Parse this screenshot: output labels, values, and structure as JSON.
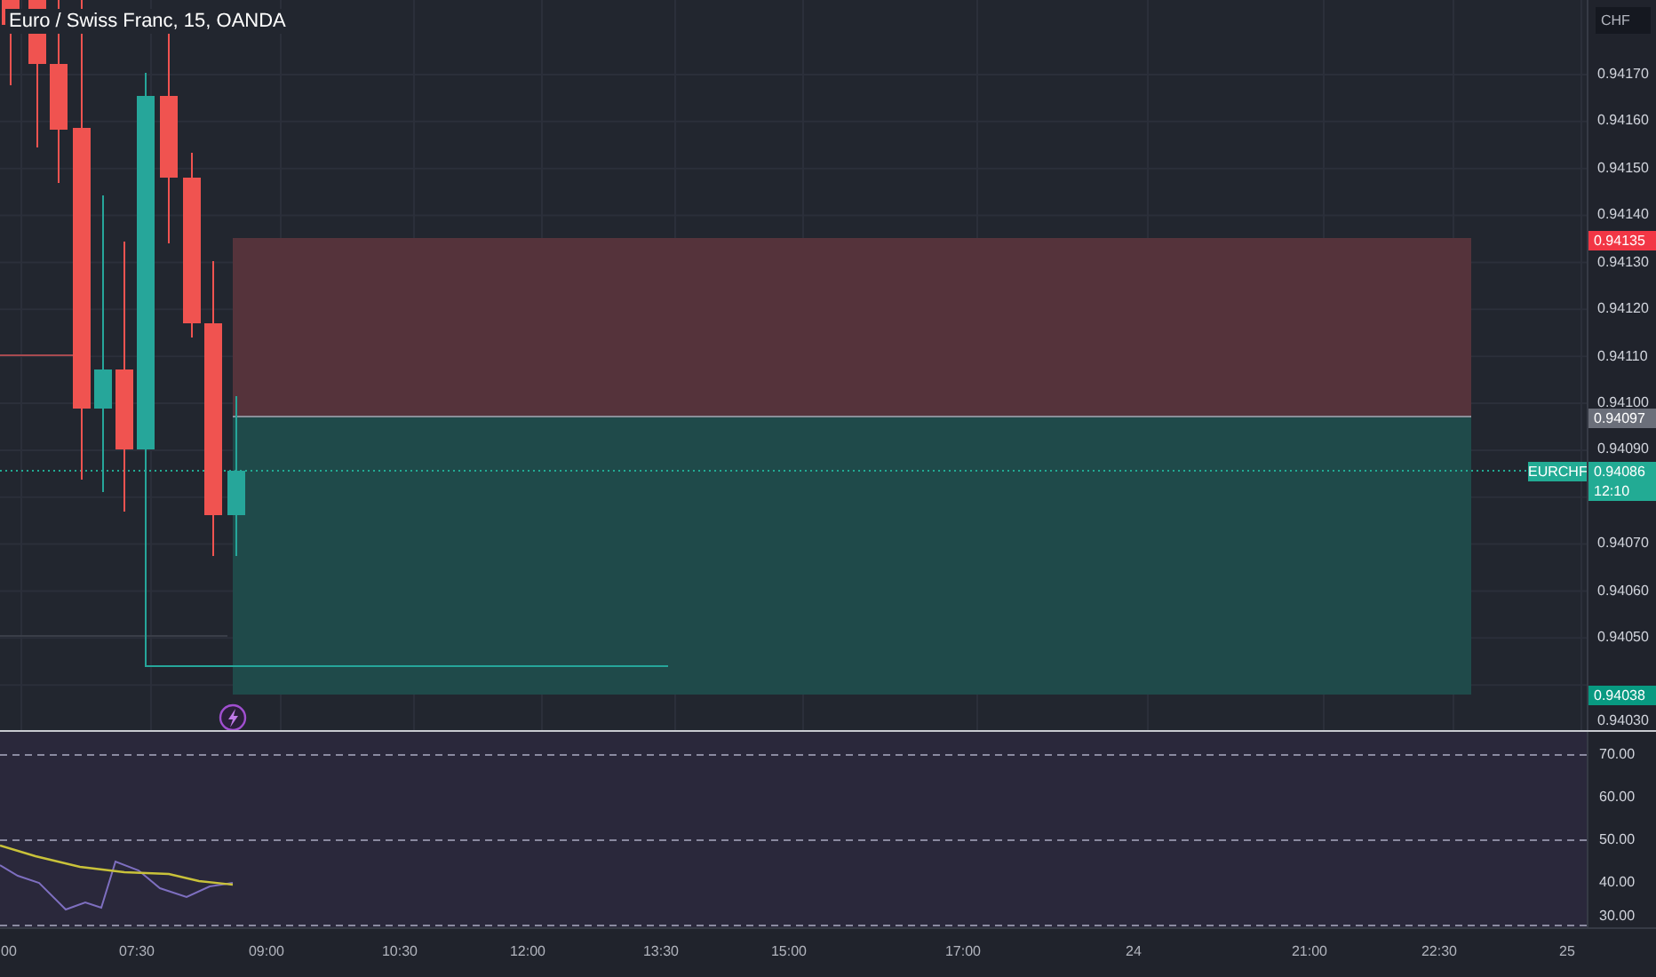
{
  "chart": {
    "title": "Euro / Swiss Franc, 15, OANDA",
    "currency_button": "CHF",
    "price_ticks": [
      "0.94170",
      "0.94160",
      "0.94150",
      "0.94140",
      "0.94130",
      "0.94120",
      "0.94110",
      "0.94100",
      "0.94090",
      "0.94070",
      "0.94060",
      "0.94050",
      "0.94030"
    ],
    "price_labels": [
      {
        "kind": "stop",
        "text": "0.94135"
      },
      {
        "kind": "entry",
        "text": "0.94097"
      },
      {
        "kind": "current",
        "text": "0.94086",
        "countdown": "12:10",
        "symbol": "EURCHF"
      },
      {
        "kind": "target",
        "text": "0.94038"
      }
    ]
  },
  "indicator": {
    "ticks": [
      "70.00",
      "60.00",
      "50.00",
      "40.00",
      "30.00"
    ]
  },
  "time_axis": {
    "labels": [
      "00",
      "07:30",
      "09:00",
      "10:30",
      "12:00",
      "13:30",
      "15:00",
      "17:00",
      "24",
      "21:00",
      "22:30",
      "25"
    ]
  }
}
